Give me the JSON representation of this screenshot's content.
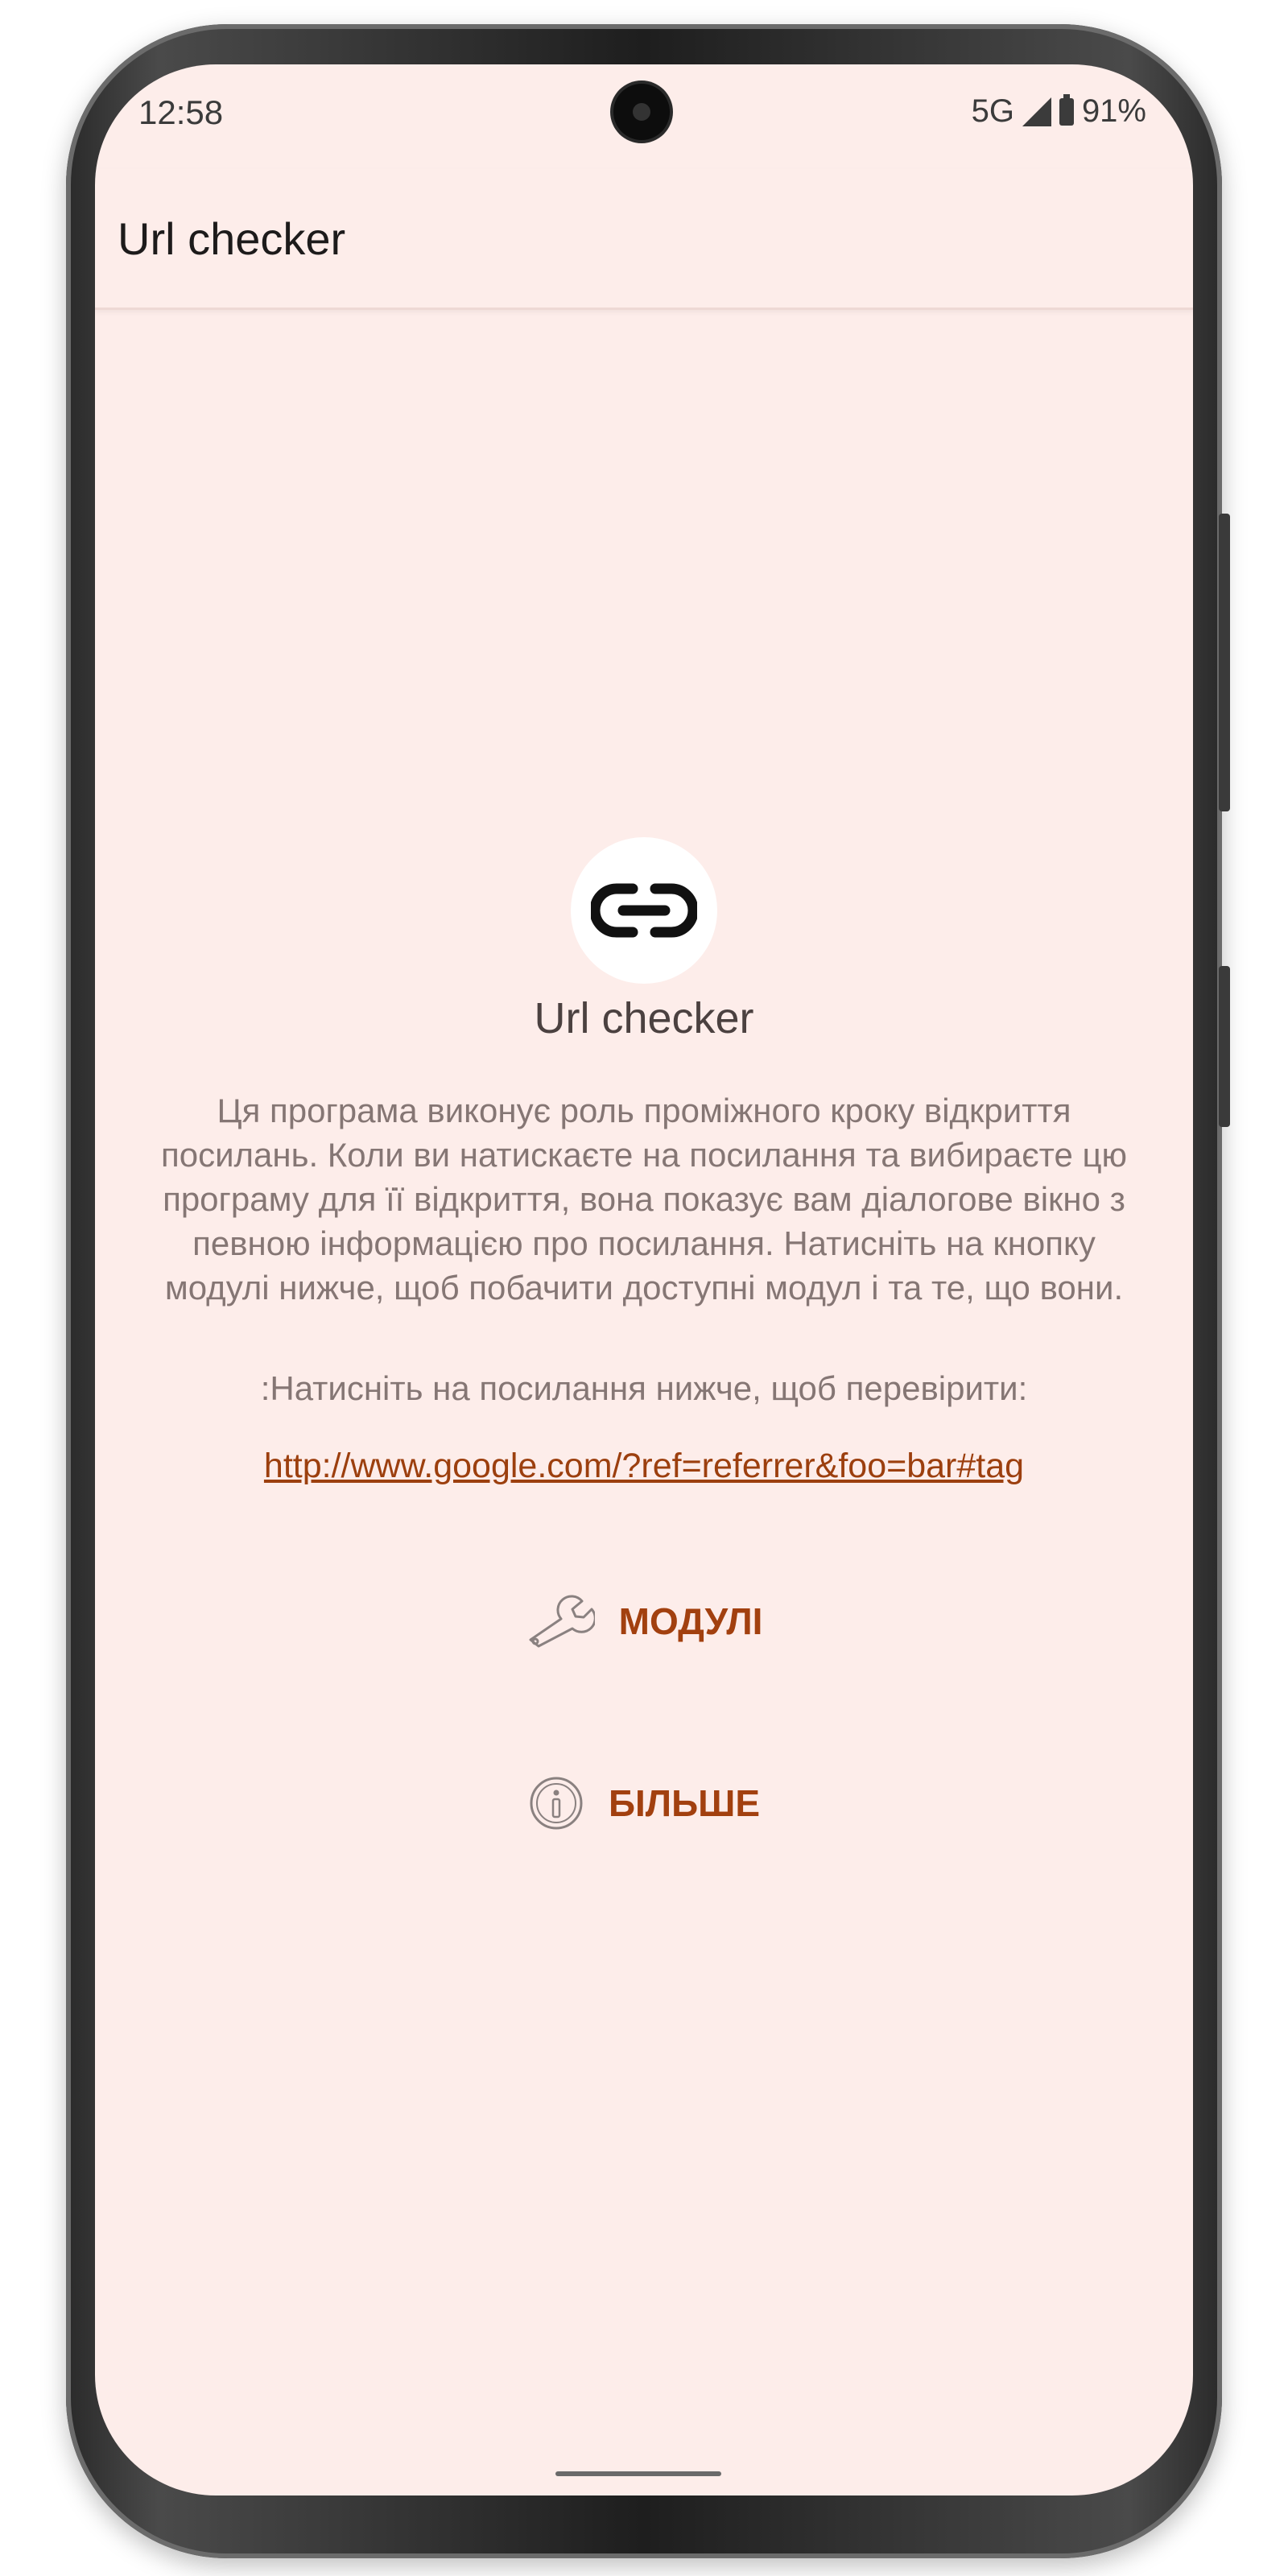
{
  "status_bar": {
    "time": "12:58",
    "network": "5G",
    "battery": "91%"
  },
  "app_bar": {
    "title": "Url checker"
  },
  "main": {
    "app_name": "Url checker",
    "description": "Ця програма виконує роль проміжного кроку відкриття посилань. Коли ви натискаєте на посилання та вибираєте цю програму для її відкриття, вона показує вам діалогове вікно з певною інформацією про посилання. Натисніть на кнопку модулі нижче, щоб побачити доступні модул і та те, що вони.",
    "prompt": ":Натисніть на посилання нижче, щоб перевірити:",
    "test_link": "http://www.google.com/?ref=referrer&foo=bar#tag",
    "modules_button": "МОДУЛІ",
    "more_button": "БІЛЬШЕ"
  },
  "icons": {
    "logo": "link-icon",
    "modules": "wrench-icon",
    "more": "info-icon"
  },
  "colors": {
    "background": "#fdedea",
    "accent": "#a2400f",
    "text_secondary": "#857674"
  }
}
